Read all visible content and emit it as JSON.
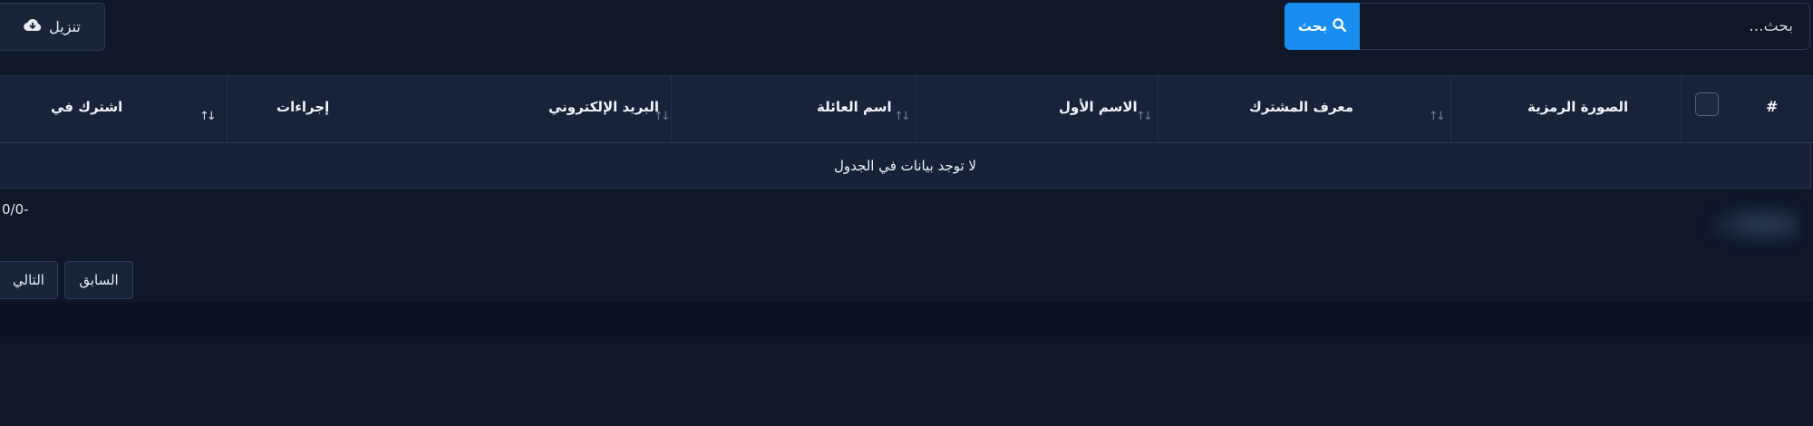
{
  "toolbar": {
    "download_label": "تنزيل",
    "search_placeholder": "بحث...",
    "search_button_label": "بحث"
  },
  "table": {
    "columns": [
      {
        "label": "#"
      },
      {
        "label": "الصورة الرمزية"
      },
      {
        "label": "معرف المشترك"
      },
      {
        "label": "الاسم الأول"
      },
      {
        "label": "اسم العائلة"
      },
      {
        "label": "البريد الإلكتروني"
      },
      {
        "label": "إجراءات"
      },
      {
        "label": "اشترك في"
      }
    ],
    "empty_message": "لا توجد بيانات في الجدول"
  },
  "pagination": {
    "range_text": "0/0-",
    "previous_label": "السابق",
    "next_label": "التالي"
  },
  "colors": {
    "accent": "#1a8ef0",
    "background": "#0f1729",
    "header_bg": "#18233a"
  }
}
